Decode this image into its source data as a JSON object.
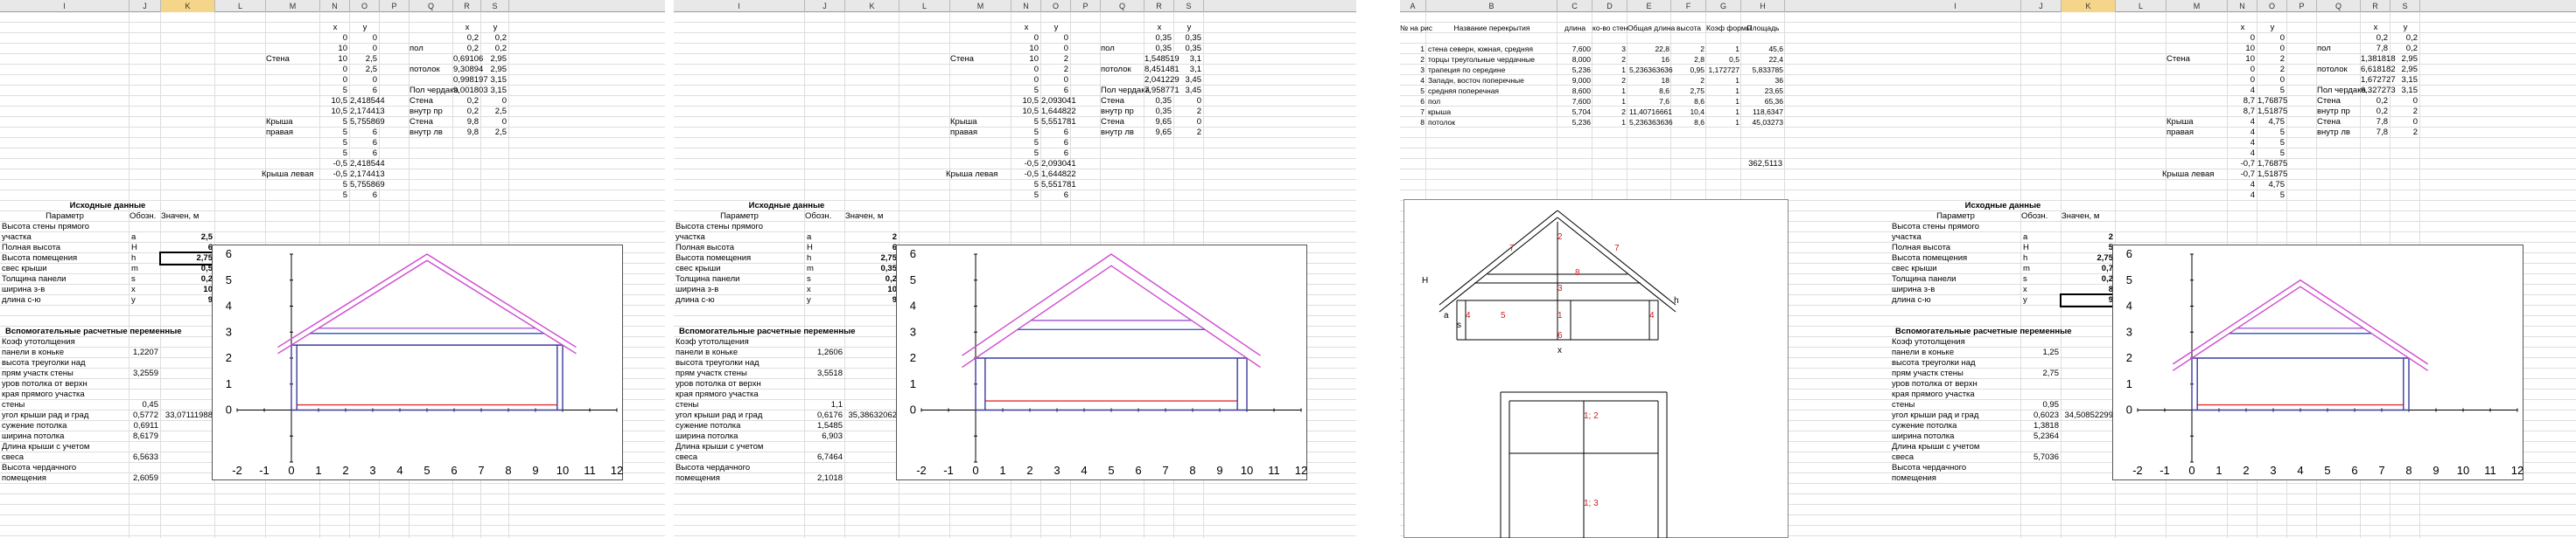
{
  "panel1": {
    "col_headers": [
      "I",
      "J",
      "K",
      "L",
      "M",
      "N",
      "O",
      "P",
      "Q",
      "R",
      "S"
    ],
    "sel_col": "K",
    "xy_head": [
      "x",
      "y"
    ],
    "stena_label": "Стена",
    "stena_x": [
      "0",
      "10",
      "10",
      "0",
      "0",
      "5",
      "10,5",
      "10,5",
      "5",
      "5",
      "5",
      "5",
      "-0,5",
      "-0,5",
      "5",
      "5"
    ],
    "stena_y": [
      "0",
      "0",
      "2,5",
      "2,5",
      "0",
      "6",
      "2,418544",
      "2,174413",
      "5,755869",
      "6",
      "6",
      "6",
      "2,418544",
      "2,174413",
      "5,755869",
      "6"
    ],
    "krysha_prav": "Крыша правая",
    "krysha_lev": "Крыша левая",
    "right_labels": [
      "пол",
      "потолок",
      "Пол чердака",
      "Стена",
      "внутр пр",
      "Стена",
      "внутр лв"
    ],
    "right_x": [
      "0,2",
      "0,2",
      "0,69106",
      "9,30894",
      "0,998197",
      "9,001803",
      "0,2",
      "0,2",
      "9,8",
      "9,8"
    ],
    "right_y": [
      "0,2",
      "0,2",
      "2,95",
      "2,95",
      "3,15",
      "3,15",
      "0",
      "2,5",
      "0",
      "2,5"
    ],
    "inputs_title": "Исходные данные",
    "param_head": [
      "Параметр",
      "Обозн.",
      "Значен, м"
    ],
    "params": [
      {
        "name": "Высота стены прямого участка",
        "sym": "a",
        "val": "2,5"
      },
      {
        "name": "Полная высота",
        "sym": "H",
        "val": "6"
      },
      {
        "name": "Высота помещения",
        "sym": "h",
        "val": "2,75"
      },
      {
        "name": "свес крыши",
        "sym": "m",
        "val": "0,5"
      },
      {
        "name": "Толщина панели",
        "sym": "s",
        "val": "0,2"
      },
      {
        "name": "ширина з-в",
        "sym": "x",
        "val": "10"
      },
      {
        "name": "длина с-ю",
        "sym": "y",
        "val": "9"
      }
    ],
    "aux_title": "Вспомогательные расчетные переменные",
    "aux": [
      {
        "name": "Коэф утотолщения панели в коньке",
        "val": "1,2207"
      },
      {
        "name": "высота треуголки над прям участк стены",
        "val": "3,2559"
      },
      {
        "name": "уров потолка от верхн края прямого участка стены",
        "val": "0,45"
      },
      {
        "name": "угол крыши рад и град",
        "val": "0,5772",
        "val2": "33,07111988"
      },
      {
        "name": "сужение потолка",
        "val": "0,6911"
      },
      {
        "name": "ширина потолка",
        "val": "8,6179"
      },
      {
        "name": "Длина крыши с учетом свеса",
        "val": "6,5633"
      },
      {
        "name": "Высота чердачного помещения",
        "val": "2,6059"
      }
    ]
  },
  "panel2": {
    "col_headers": [
      "I",
      "J",
      "K",
      "L",
      "M",
      "N",
      "O",
      "P",
      "Q",
      "R",
      "S"
    ],
    "stena_x": [
      "0",
      "10",
      "10",
      "0",
      "0",
      "5",
      "10,5",
      "10,5",
      "5",
      "5",
      "5",
      "5",
      "-0,5",
      "-0,5",
      "5",
      "5"
    ],
    "stena_y": [
      "0",
      "0",
      "2",
      "2",
      "0",
      "6",
      "2,093041",
      "1,644822",
      "5,551781",
      "6",
      "6",
      "6",
      "2,093041",
      "1,644822",
      "5,551781",
      "6"
    ],
    "right_x": [
      "0,35",
      "0,35",
      "1,548519",
      "8,451481",
      "2,041229",
      "7,958771",
      "0,35",
      "0,35",
      "9,65",
      "9,65"
    ],
    "right_y": [
      "0,35",
      "0,35",
      "3,1",
      "3,1",
      "3,45",
      "3,45",
      "0",
      "2",
      "0",
      "2"
    ],
    "params_val": [
      "2",
      "6",
      "2,75",
      "0,35",
      "0,2",
      "10",
      "9"
    ],
    "aux_val": [
      "1,2606",
      "3,5518",
      "1,1",
      "0,6176",
      "1,5485",
      "6,903",
      "6,7464",
      "2,1018"
    ],
    "aux_val2": "35,38632062"
  },
  "panel3": {
    "col_headers": [
      "A",
      "B",
      "C",
      "D",
      "E",
      "F",
      "G",
      "H"
    ],
    "table_head": [
      "№ на рис",
      "Название перекрытия",
      "длина",
      "ко-во стен",
      "Общая длина",
      "высота",
      "Коэф формы",
      "Площадь"
    ],
    "table_rows": [
      [
        "1",
        "стена северн, южная, средняя",
        "7,600",
        "3",
        "22,8",
        "2",
        "1",
        "45,6"
      ],
      [
        "2",
        "торцы треугольные чердачные",
        "8,000",
        "2",
        "16",
        "2,8",
        "0,5",
        "22,4"
      ],
      [
        "3",
        "трапеция по середине",
        "5,236",
        "1",
        "5,236363636",
        "0,95",
        "1,172727",
        "5,833785"
      ],
      [
        "4",
        "Западн, восточ поперечные",
        "9,000",
        "2",
        "18",
        "2",
        "1",
        "36"
      ],
      [
        "5",
        "средняя поперечная",
        "8,600",
        "1",
        "8,6",
        "2,75",
        "1",
        "23,65"
      ],
      [
        "6",
        "пол",
        "7,600",
        "1",
        "7,6",
        "8,6",
        "1",
        "65,36"
      ],
      [
        "7",
        "крыша",
        "5,704",
        "2",
        "11,40716661",
        "10,4",
        "1",
        "118,6347"
      ],
      [
        "8",
        "потолок",
        "5,236",
        "1",
        "5,236363636",
        "8,6",
        "1",
        "45,03273"
      ]
    ],
    "total": "362,5113",
    "drawing_labels": [
      "2",
      "7",
      "7",
      "8",
      "3",
      "1",
      "4",
      "5",
      "4",
      "6",
      "H",
      "a",
      "s",
      "h",
      "x",
      "1; 2",
      "1; 3"
    ]
  },
  "panel4": {
    "col_headers": [
      "I",
      "J",
      "K",
      "L",
      "M",
      "N",
      "O",
      "P",
      "Q",
      "R",
      "S"
    ],
    "stena_x": [
      "0",
      "10",
      "10",
      "0",
      "0",
      "4",
      "8,7",
      "8,7",
      "4",
      "4",
      "4",
      "4",
      "-0,7",
      "-0,7",
      "4",
      "4"
    ],
    "stena_y": [
      "0",
      "0",
      "2",
      "2",
      "0",
      "5",
      "1,76875",
      "1,51875",
      "4,75",
      "5",
      "5",
      "5",
      "1,76875",
      "1,51875",
      "4,75",
      "5"
    ],
    "right_x": [
      "0,2",
      "7,8",
      "1,381818",
      "6,618182",
      "1,672727",
      "6,327273",
      "0,2",
      "0,2",
      "7,8",
      "7,8"
    ],
    "right_y": [
      "0,2",
      "0,2",
      "2,95",
      "2,95",
      "3,15",
      "3,15",
      "0",
      "2",
      "0",
      "2"
    ],
    "params_val": [
      "2",
      "5",
      "2,75",
      "0,7",
      "0,2",
      "8",
      "9"
    ],
    "aux_val": [
      "1,25",
      "2,75",
      "0,95",
      "0,6023",
      "1,3818",
      "5,2364",
      "5,7036",
      ""
    ],
    "aux_val2": "34,50852299"
  },
  "chart_data": [
    {
      "type": "line",
      "title": "",
      "xlim": [
        -2,
        12
      ],
      "ylim": [
        -2,
        6
      ],
      "xticks": [
        "-2",
        "-1",
        "0",
        "1",
        "2",
        "3",
        "4",
        "5",
        "6",
        "7",
        "8",
        "9",
        "10",
        "11",
        "12"
      ],
      "yticks": [
        "-2",
        "-1",
        "0",
        "1",
        "2",
        "3",
        "4",
        "5",
        "6"
      ],
      "series": [
        {
          "color": "#3b3b9e",
          "x": [
            0,
            10,
            10,
            0,
            0
          ],
          "y": [
            0,
            0,
            2.5,
            2.5,
            0
          ]
        },
        {
          "color": "#d04ad0",
          "x": [
            -0.5,
            5,
            10.5
          ],
          "y": [
            2.418544,
            6,
            2.418544
          ]
        },
        {
          "color": "#d04ad0",
          "x": [
            -0.5,
            5,
            10.5
          ],
          "y": [
            2.174413,
            5.755869,
            2.174413
          ]
        },
        {
          "color": "#e03030",
          "x": [
            0.2,
            9.8
          ],
          "y": [
            0.2,
            0.2
          ]
        },
        {
          "color": "#4060c0",
          "x": [
            0.69106,
            9.30894
          ],
          "y": [
            2.95,
            2.95
          ]
        },
        {
          "color": "#a060d0",
          "x": [
            0.998197,
            9.001803
          ],
          "y": [
            3.15,
            3.15
          ]
        },
        {
          "color": "#3b3b9e",
          "x": [
            0.2,
            0.2
          ],
          "y": [
            0,
            2.5
          ]
        },
        {
          "color": "#3b3b9e",
          "x": [
            9.8,
            9.8
          ],
          "y": [
            0,
            2.5
          ]
        }
      ]
    },
    {
      "type": "line",
      "title": "",
      "xlim": [
        -2,
        12
      ],
      "ylim": [
        -2,
        6
      ],
      "xticks": [
        "-2",
        "-1",
        "0",
        "1",
        "2",
        "3",
        "4",
        "5",
        "6",
        "7",
        "8",
        "9",
        "10",
        "11",
        "12"
      ],
      "yticks": [
        "-2",
        "-1",
        "0",
        "1",
        "2",
        "3",
        "4",
        "5",
        "6"
      ],
      "series": [
        {
          "color": "#3b3b9e",
          "x": [
            0,
            10,
            10,
            0,
            0
          ],
          "y": [
            0,
            0,
            2,
            2,
            0
          ]
        },
        {
          "color": "#d04ad0",
          "x": [
            -0.5,
            5,
            10.5
          ],
          "y": [
            2.093041,
            6,
            2.093041
          ]
        },
        {
          "color": "#d04ad0",
          "x": [
            -0.5,
            5,
            10.5
          ],
          "y": [
            1.644822,
            5.551781,
            1.644822
          ]
        },
        {
          "color": "#e03030",
          "x": [
            0.35,
            9.65
          ],
          "y": [
            0.35,
            0.35
          ]
        },
        {
          "color": "#4060c0",
          "x": [
            1.548519,
            8.451481
          ],
          "y": [
            3.1,
            3.1
          ]
        },
        {
          "color": "#a060d0",
          "x": [
            2.041229,
            7.958771
          ],
          "y": [
            3.45,
            3.45
          ]
        },
        {
          "color": "#3b3b9e",
          "x": [
            0.35,
            0.35
          ],
          "y": [
            0,
            2
          ]
        },
        {
          "color": "#3b3b9e",
          "x": [
            9.65,
            9.65
          ],
          "y": [
            0,
            2
          ]
        }
      ]
    },
    {
      "type": "line",
      "title": "",
      "xlim": [
        -2,
        12
      ],
      "ylim": [
        -2,
        6
      ],
      "xticks": [
        "-2",
        "-1",
        "0",
        "1",
        "2",
        "3",
        "4",
        "5",
        "6",
        "7",
        "8",
        "9",
        "10",
        "11",
        "12"
      ],
      "yticks": [
        "-2",
        "-1",
        "0",
        "1",
        "2",
        "3",
        "4",
        "5",
        "6"
      ],
      "series": [
        {
          "color": "#3b3b9e",
          "x": [
            0,
            8,
            8,
            0,
            0
          ],
          "y": [
            0,
            0,
            2,
            2,
            0
          ]
        },
        {
          "color": "#d04ad0",
          "x": [
            -0.7,
            4,
            8.7
          ],
          "y": [
            1.76875,
            5,
            1.76875
          ]
        },
        {
          "color": "#d04ad0",
          "x": [
            -0.7,
            4,
            8.7
          ],
          "y": [
            1.51875,
            4.75,
            1.51875
          ]
        },
        {
          "color": "#e03030",
          "x": [
            0.2,
            7.8
          ],
          "y": [
            0.2,
            0.2
          ]
        },
        {
          "color": "#4060c0",
          "x": [
            1.381818,
            6.618182
          ],
          "y": [
            2.95,
            2.95
          ]
        },
        {
          "color": "#a060d0",
          "x": [
            1.672727,
            6.327273
          ],
          "y": [
            3.15,
            3.15
          ]
        },
        {
          "color": "#3b3b9e",
          "x": [
            0.2,
            0.2
          ],
          "y": [
            0,
            2
          ]
        },
        {
          "color": "#3b3b9e",
          "x": [
            7.8,
            7.8
          ],
          "y": [
            0,
            2
          ]
        }
      ]
    }
  ]
}
